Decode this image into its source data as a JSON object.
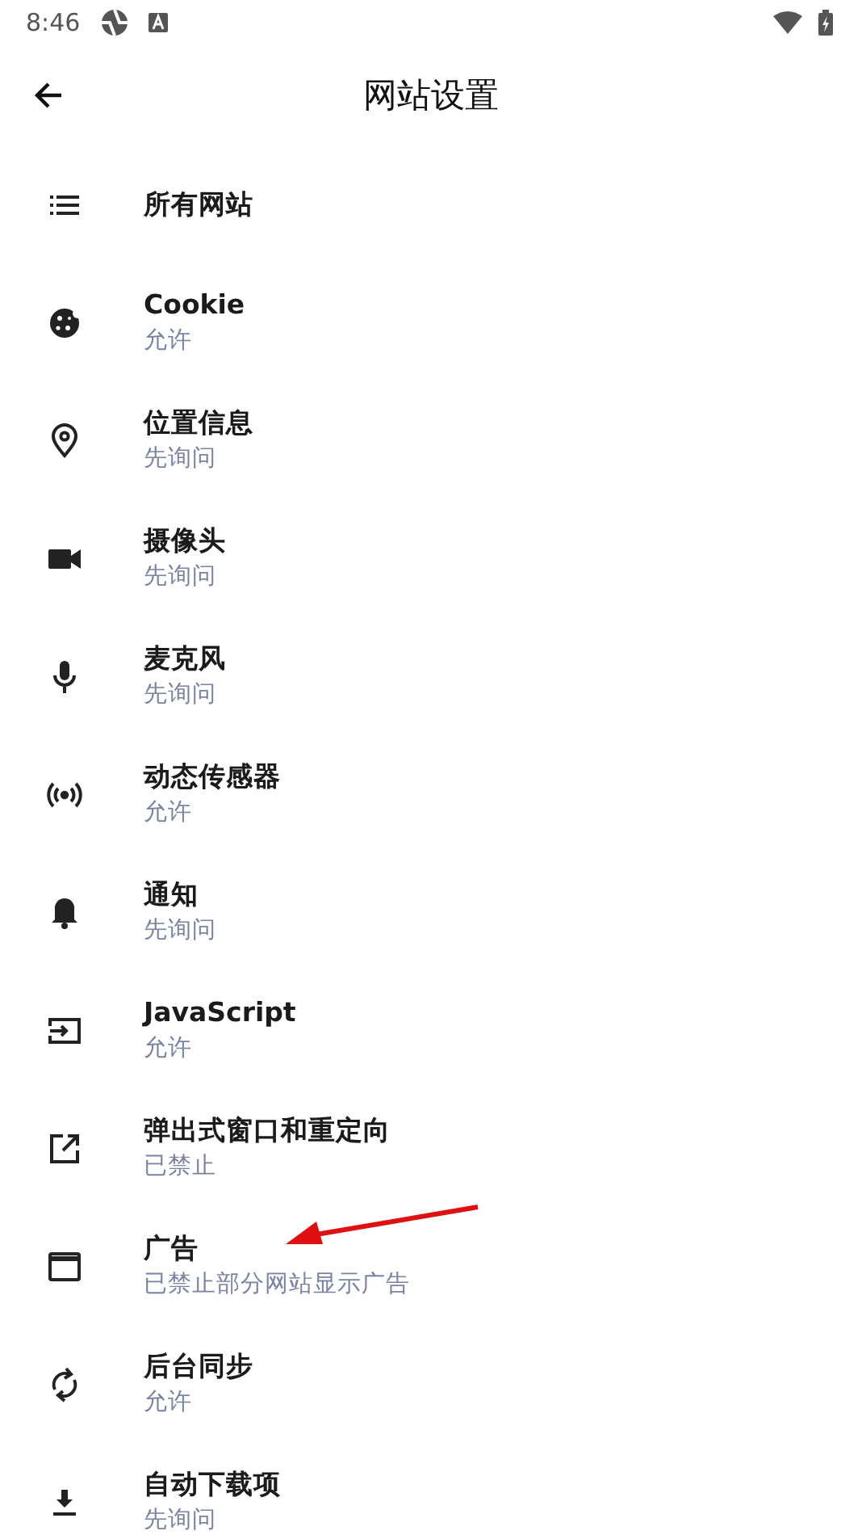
{
  "status_bar": {
    "time": "8:46"
  },
  "toolbar": {
    "title": "网站设置"
  },
  "items": [
    {
      "title": "所有网站"
    },
    {
      "title": "Cookie",
      "subtitle": "允许"
    },
    {
      "title": "位置信息",
      "subtitle": "先询问"
    },
    {
      "title": "摄像头",
      "subtitle": "先询问"
    },
    {
      "title": "麦克风",
      "subtitle": "先询问"
    },
    {
      "title": "动态传感器",
      "subtitle": "允许"
    },
    {
      "title": "通知",
      "subtitle": "先询问"
    },
    {
      "title": "JavaScript",
      "subtitle": "允许"
    },
    {
      "title": "弹出式窗口和重定向",
      "subtitle": "已禁止"
    },
    {
      "title": "广告",
      "subtitle": "已禁止部分网站显示广告"
    },
    {
      "title": "后台同步",
      "subtitle": "允许"
    },
    {
      "title": "自动下载项",
      "subtitle": "先询问"
    }
  ]
}
